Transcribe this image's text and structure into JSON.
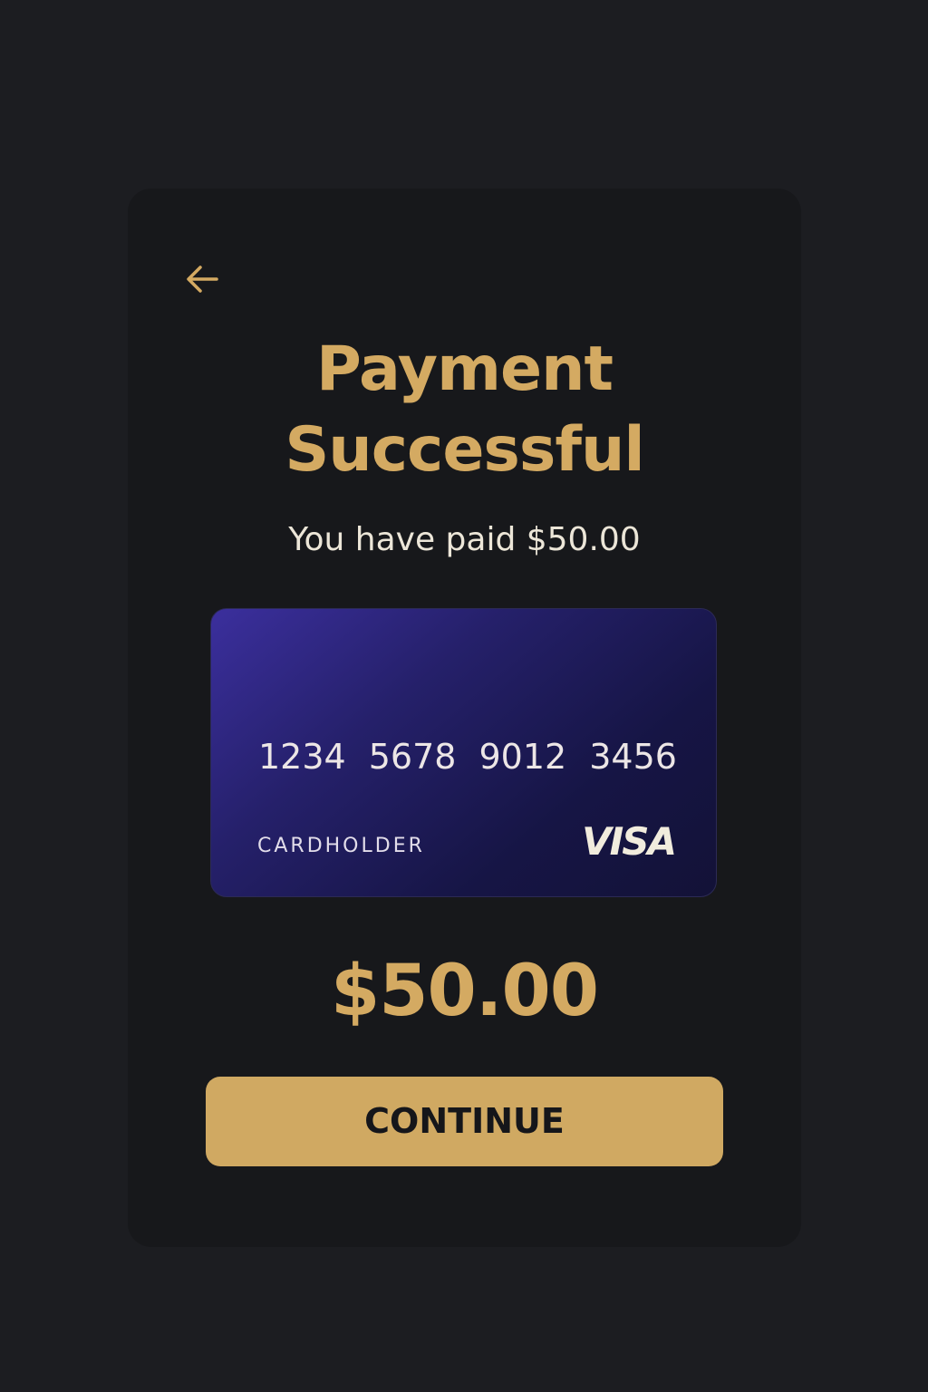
{
  "header": {
    "back_icon": "arrow-left-icon",
    "title_line1": "Payment",
    "title_line2": "Successful"
  },
  "message": "You have paid $50.00",
  "card": {
    "number_groups": [
      "1234",
      "5678",
      "9012",
      "3456"
    ],
    "holder_label": "CARDHOLDER",
    "brand": "VISA"
  },
  "amount": "$50.00",
  "actions": {
    "continue_label": "CONTINUE"
  },
  "colors": {
    "background": "#1c1d21",
    "panel": "#17181b",
    "accent_gold": "#d4aa62",
    "button_gold": "#d0a962",
    "card_gradient_start": "#3b2f9d",
    "card_gradient_end": "#131237"
  }
}
